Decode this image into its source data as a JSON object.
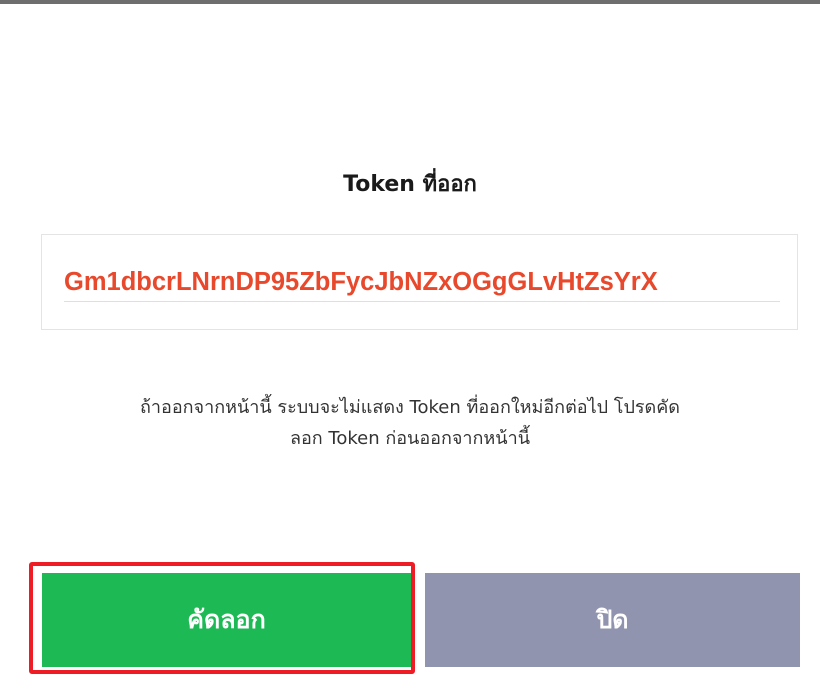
{
  "dialog": {
    "title": "Token ที่ออก",
    "token_value": "Gm1dbcrLNrnDP95ZbFycJbNZxOGgGLvHtZsYrX",
    "warning_line1": "ถ้าออกจากหน้านี้ ระบบจะไม่แสดง Token ที่ออกใหม่อีกต่อไป โปรดคัด",
    "warning_line2": "ลอก Token ก่อนออกจากหน้านี้"
  },
  "buttons": {
    "copy_label": "คัดลอก",
    "close_label": "ปิด"
  },
  "colors": {
    "token_text": "#e8492c",
    "copy_button": "#1db954",
    "close_button": "#9094ae",
    "highlight_border": "#ee1c25"
  }
}
